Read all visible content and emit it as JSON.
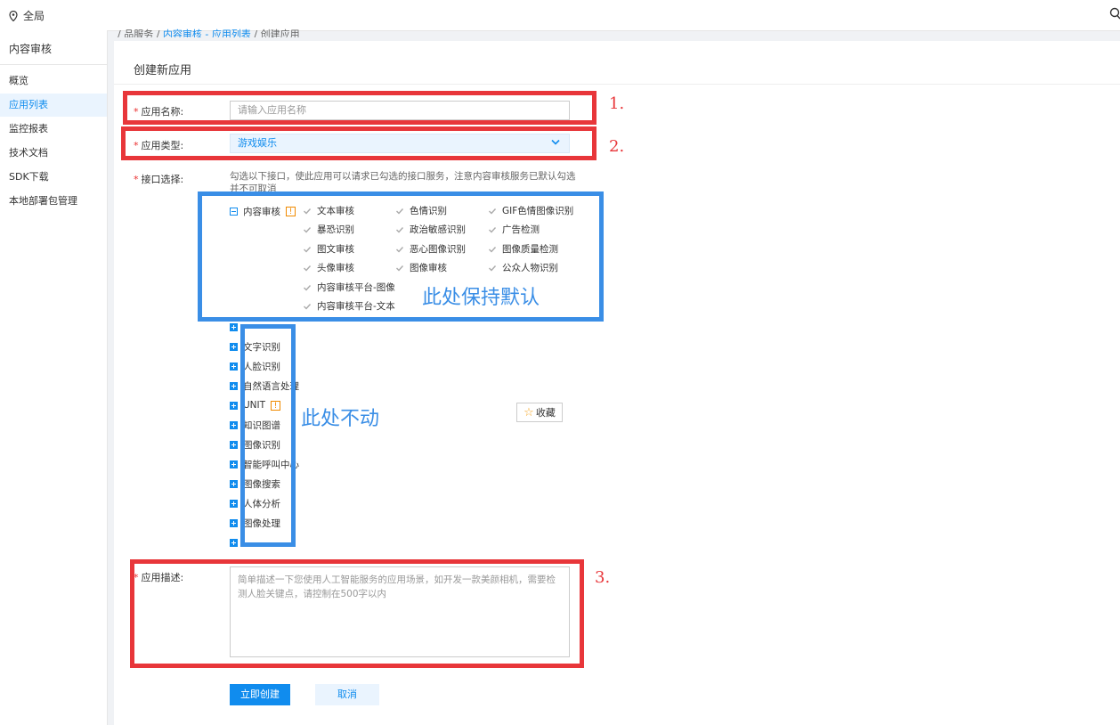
{
  "topbar": {
    "region": "全局"
  },
  "sidebar": {
    "title": "内容审核",
    "items": [
      {
        "label": "概览",
        "active": false
      },
      {
        "label": "应用列表",
        "active": true
      },
      {
        "label": "监控报表",
        "active": false
      },
      {
        "label": "技术文档",
        "active": false
      },
      {
        "label": "SDK下载",
        "active": false
      },
      {
        "label": "本地部署包管理",
        "active": false
      }
    ]
  },
  "breadcrumb": {
    "prefix": "/ 品服务 / ",
    "link": "内容审核 - 应用列表",
    "suffix": " / 创建应用"
  },
  "page": {
    "title": "创建新应用"
  },
  "form": {
    "name_label": "应用名称:",
    "name_placeholder": "请输入应用名称",
    "type_label": "应用类型:",
    "type_value": "游戏娱乐",
    "api_label": "接口选择:",
    "api_hint": "勾选以下接口，使此应用可以请求已勾选的接口服务，注意内容审核服务已默认勾选并不可取消",
    "content_group": "内容审核",
    "content_items": [
      "文本审核",
      "色情识别",
      "GIF色情图像识别",
      "暴恐识别",
      "政治敏感识别",
      "广告检测",
      "图文审核",
      "恶心图像识别",
      "图像质量检测",
      "头像审核",
      "图像审核",
      "公众人物识别",
      "内容审核平台-图像",
      "内容审核平台-文本"
    ],
    "other_groups": [
      "",
      "文字识别",
      "人脸识别",
      "自然语言处理",
      "UNIT",
      "知识图谱",
      "图像识别",
      "智能呼叫中心",
      "图像搜索",
      "人体分析",
      "图像处理",
      ""
    ],
    "fav_label": "收藏",
    "desc_label": "应用描述:",
    "desc_placeholder": "简单描述一下您使用人工智能服务的应用场景，如开发一款美颜相机，需要检测人脸关键点，请控制在500字以内",
    "create_label": "立即创建",
    "cancel_label": "取消"
  },
  "annotations": {
    "n1": "1.",
    "n2": "2.",
    "n3": "3.",
    "keep_default": "此处保持默认",
    "dont_touch": "此处不动"
  },
  "colors": {
    "accent": "#108cee",
    "red_box": "#e8363a",
    "blue_box": "#3a8ee6"
  }
}
